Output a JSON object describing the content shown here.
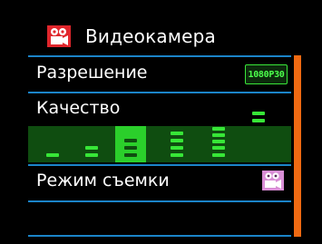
{
  "header": {
    "title": "Видеокамера",
    "icon": "video-camera-icon"
  },
  "menu": {
    "items": [
      {
        "label": "Разрешение",
        "value": "1080P30"
      },
      {
        "label": "Качество",
        "levels": 6,
        "selected_level": 3
      },
      {
        "label": "Режим съемки",
        "value_icon": "video-mode-icon"
      },
      {
        "label": ""
      }
    ]
  },
  "colors": {
    "background": "#000000",
    "divider": "#1b84c8",
    "accent_green": "#37e637",
    "strip_green": "#0f4d10",
    "scrollbar": "#e45b10",
    "icon_red": "#e0262c",
    "icon_pink": "#d98ed6"
  }
}
